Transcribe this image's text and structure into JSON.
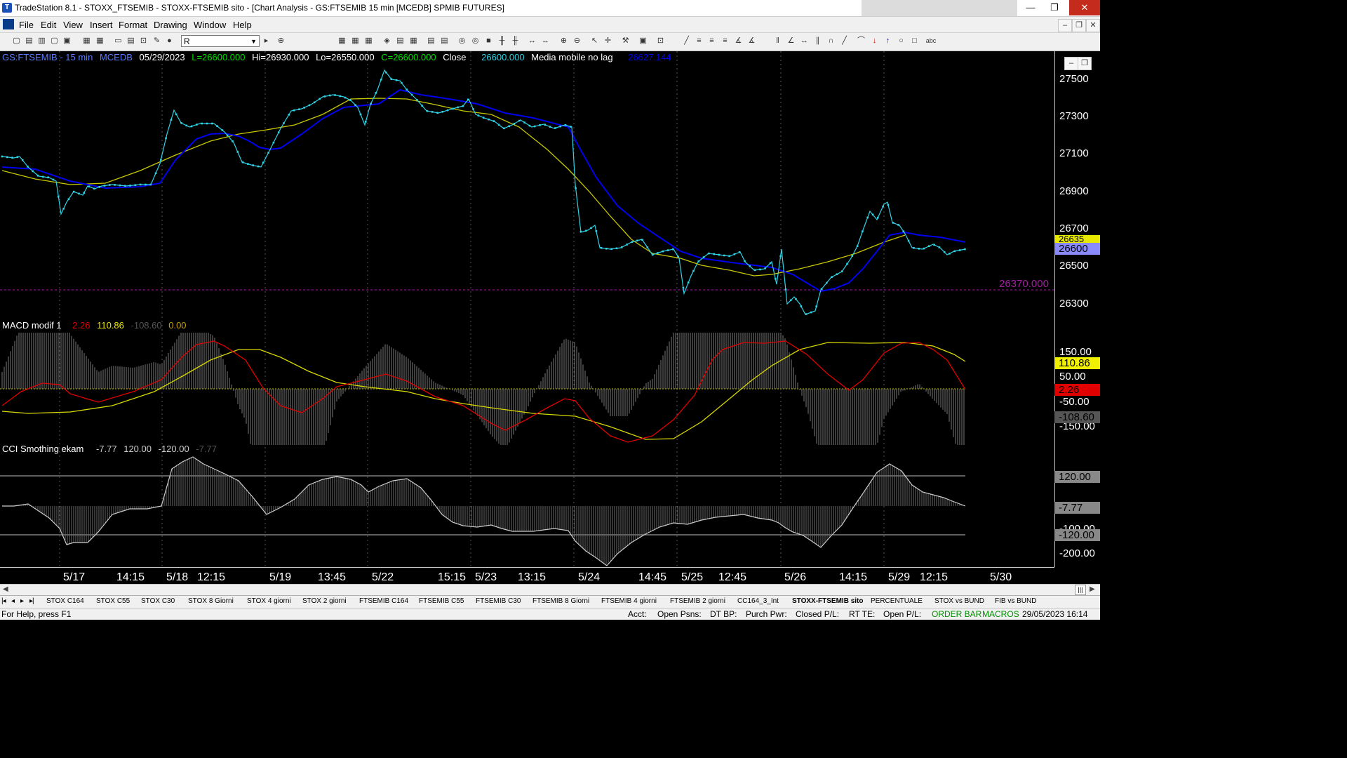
{
  "window": {
    "title": "TradeStation 8.1 - STOXX_FTSEMIB - STOXX-FTSEMIB sito - [Chart Analysis - GS:FTSEMIB  15 min  [MCEDB] SPMIB FUTURES]",
    "minimize": "—",
    "maximize": "❐",
    "close": "✕"
  },
  "menu": [
    "File",
    "Edit",
    "View",
    "Insert",
    "Format",
    "Drawing",
    "Window",
    "Help"
  ],
  "mdi_controls": [
    "–",
    "❐",
    "✕"
  ],
  "toolbar": {
    "symbol_value": "R"
  },
  "chart": {
    "header": {
      "symbol": "GS:FTSEMIB - 15 min",
      "data_source": "MCEDB",
      "date": "05/29/2023",
      "last": "L=26600.000",
      "high": "Hi=26930.000",
      "low": "Lo=26550.000",
      "close": "C=26600.000",
      "close_label": "Close",
      "close_value": "26600.000",
      "ma_label": "Media mobile no lag",
      "ma_value": "26627.144"
    },
    "price_scale": [
      "27500",
      "27300",
      "27100",
      "26900",
      "26700",
      "26500",
      "26300"
    ],
    "price_labels": {
      "ma_yellow": "26635",
      "last": "26600",
      "hline": "26370.000"
    },
    "macd": {
      "title": "MACD modif 1",
      "v1": "2.26",
      "v2": "110.86",
      "v3": "-108.60",
      "v4": "0.00",
      "scale": [
        "150.00",
        "50.00",
        "-50.00",
        "-150.00"
      ],
      "labels": {
        "yellow": "110.86",
        "red": "2.26",
        "hist": "-108.60"
      }
    },
    "cci": {
      "title": "CCI Smothing ekam",
      "v1": "-7.77",
      "v2": "120.00",
      "v3": "-120.00",
      "v4": "-7.77",
      "scale": [
        "-100.00",
        "-200.00"
      ],
      "labels": {
        "upper": "120.00",
        "value": "-7.77",
        "lower": "-120.00"
      }
    },
    "x_labels": [
      "5/17",
      "14:15",
      "5/18",
      "12:15",
      "5/19",
      "13:45",
      "5/22",
      "15:15",
      "5/23",
      "13:15",
      "5/24",
      "14:45",
      "5/25",
      "12:45",
      "5/26",
      "14:15",
      "5/29",
      "12:15",
      "5/30"
    ],
    "colors": {
      "price": "#2ed3e6",
      "ma_blue": "#0000ee",
      "ma_yellow": "#c8c800",
      "macd_red": "#e00000",
      "hline": "#a020a0"
    }
  },
  "workbook_tabs": [
    "STOX C164",
    "STOX C55",
    "STOX  C30",
    "STOX  8 Giorni",
    "STOX 4 giorni",
    "STOX  2 giorni",
    "FTSEMIB C164",
    "FTSEMIB C55",
    "FTSEMIB C30",
    "FTSEMIB  8 Giorni",
    "FTSEMIB  4 giorni",
    "FTSEMIB  2 giorni",
    "CC164_3_Int",
    "STOXX-FTSEMIB sito",
    "PERCENTUALE",
    "STOX vs BUND",
    "FIB vs BUND"
  ],
  "active_tab": "STOXX-FTSEMIB sito",
  "status": {
    "help": "For Help, press F1",
    "acct": "Acct:",
    "open_psns": "Open Psns:",
    "dt_bp": "DT BP:",
    "purch_pwr": "Purch Pwr:",
    "closed_pl": "Closed P/L:",
    "rt_te": "RT TE:",
    "open_pl": "Open P/L:",
    "order_bar": "ORDER BAR",
    "macros": "MACROS",
    "datetime": "29/05/2023 16:14"
  }
}
